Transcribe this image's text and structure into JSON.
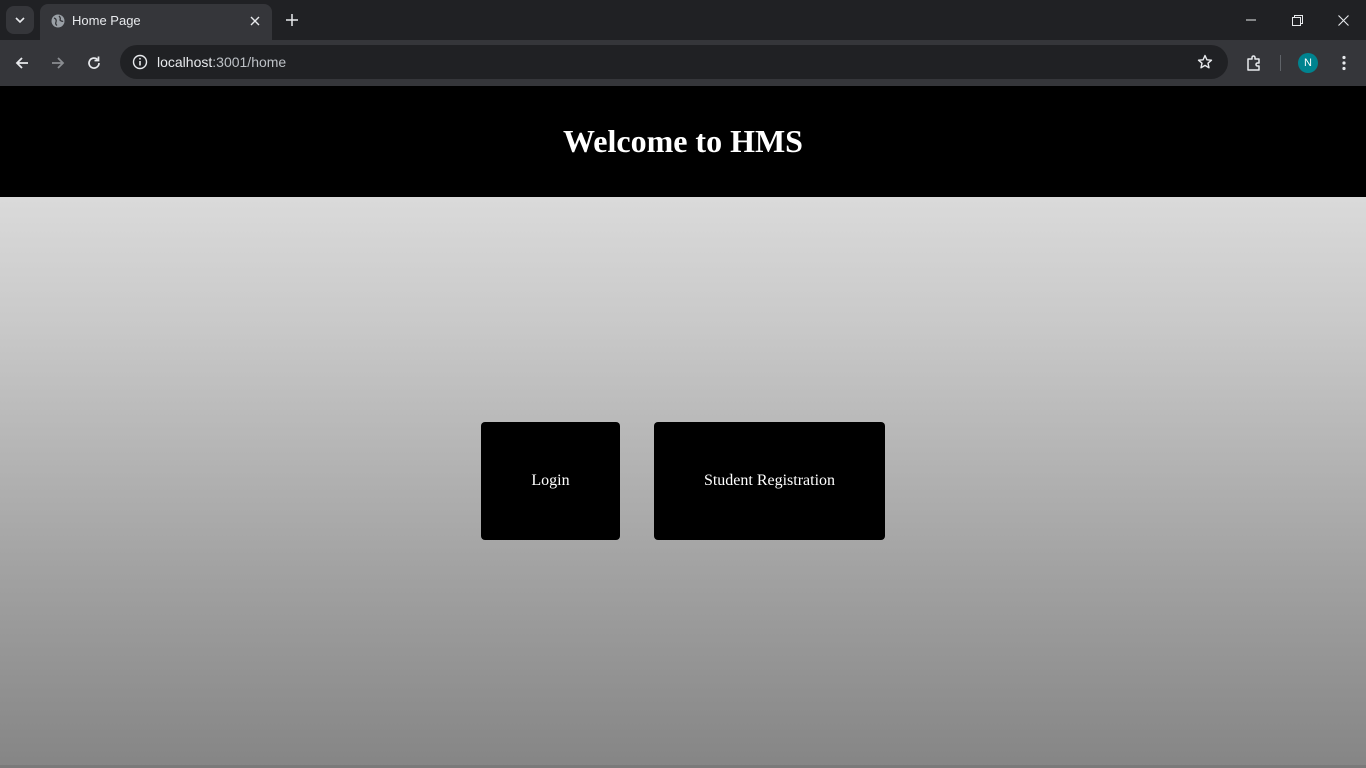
{
  "browser": {
    "tab": {
      "title": "Home Page"
    },
    "address_bar": {
      "host": "localhost",
      "path": ":3001/home"
    },
    "profile_initial": "N",
    "icons": [
      "tab-search-icon",
      "globe-icon",
      "close-icon",
      "plus-icon",
      "minimize-icon",
      "restore-icon",
      "window-close-icon",
      "back-arrow-icon",
      "forward-arrow-icon",
      "reload-icon",
      "info-icon",
      "star-icon",
      "extensions-icon",
      "kebab-menu-icon"
    ]
  },
  "page": {
    "header_title": "Welcome to HMS",
    "buttons": {
      "login": "Login",
      "student_registration": "Student Registration"
    }
  },
  "colors": {
    "header_bg": "#000000",
    "button_bg": "#000000",
    "button_text": "#ffffff",
    "avatar_bg": "#00838f"
  }
}
